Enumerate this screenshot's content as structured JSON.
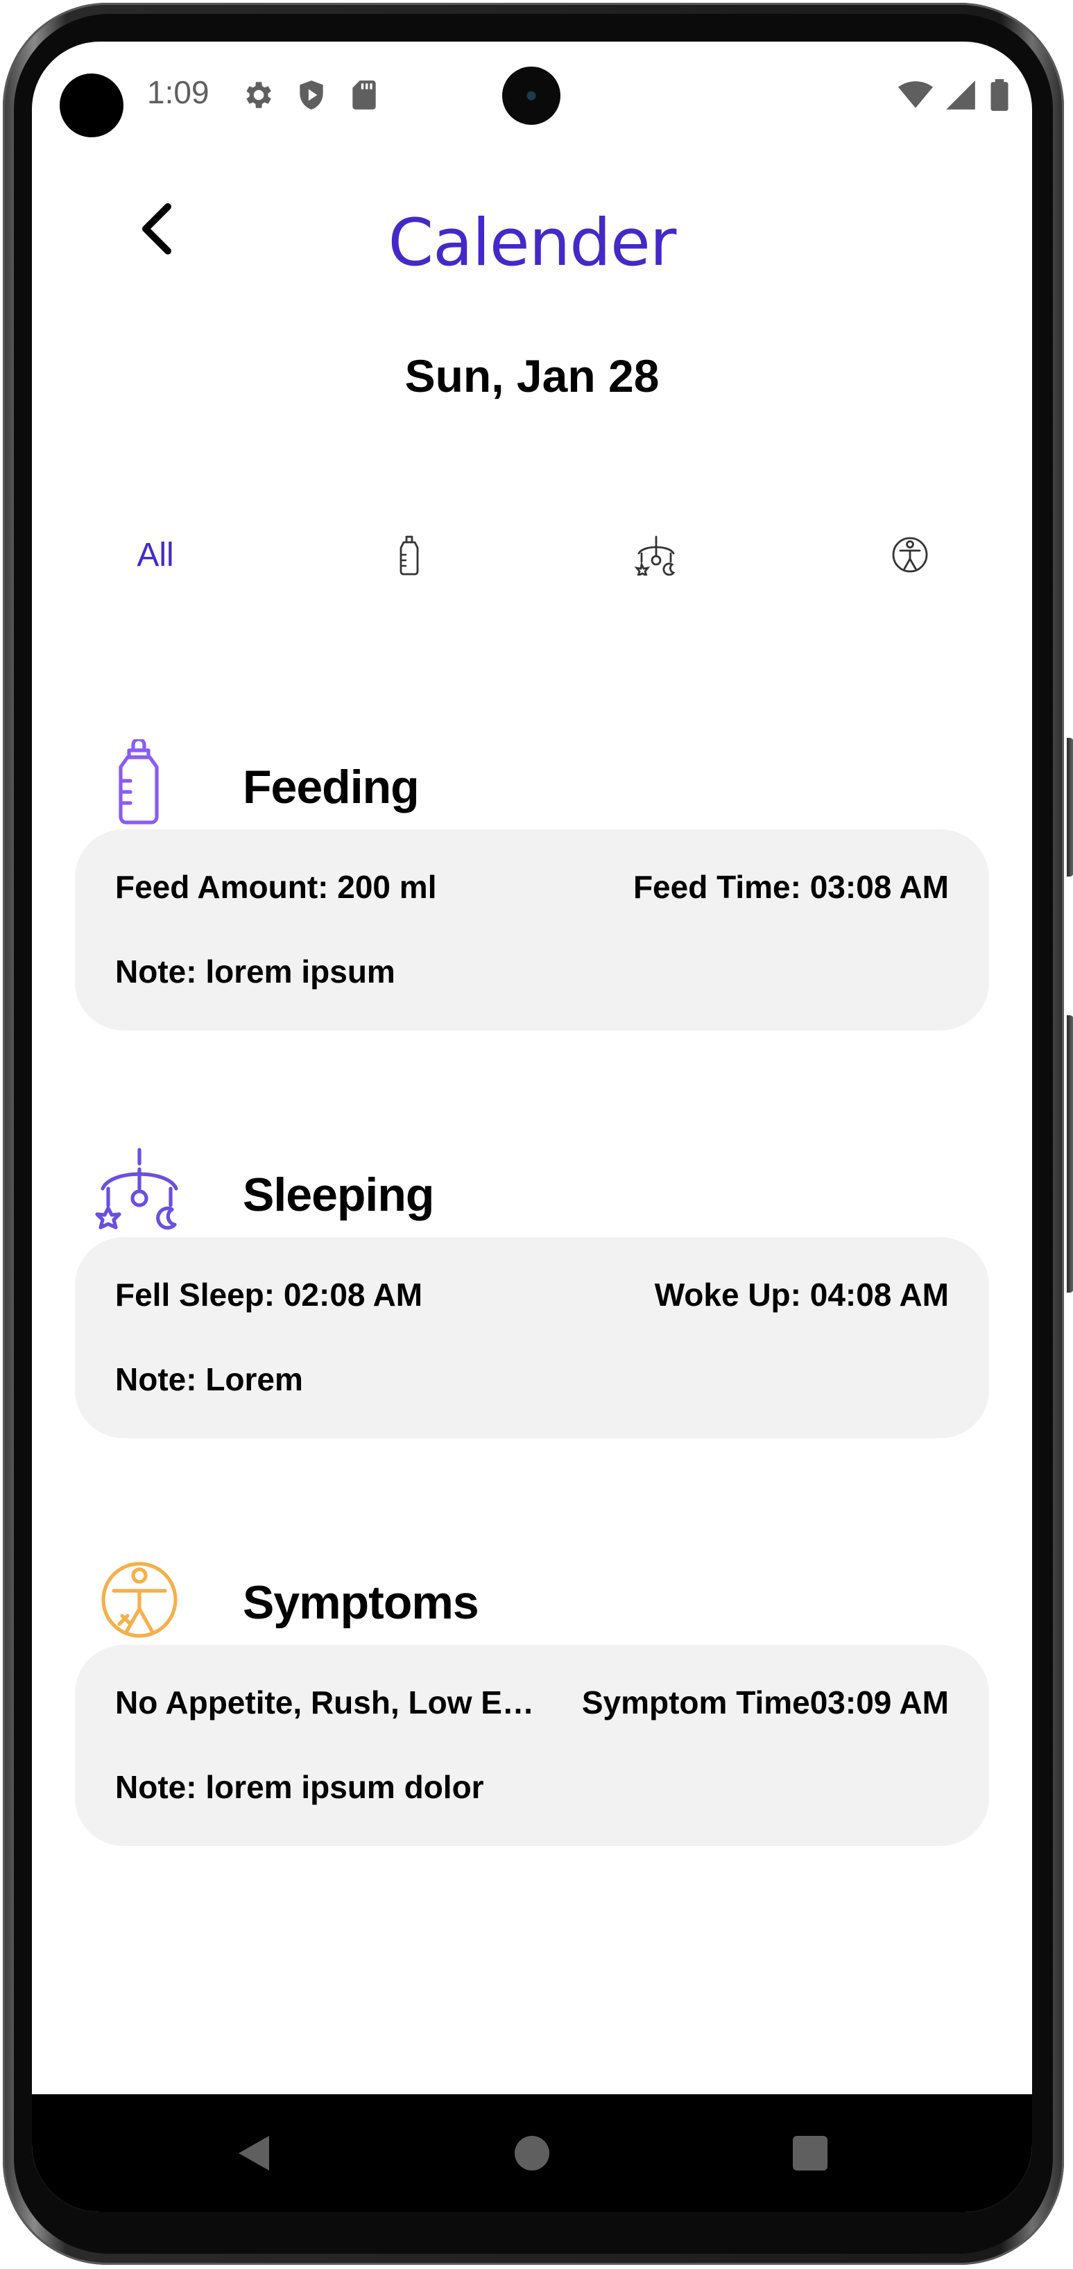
{
  "status_bar": {
    "time": "1:09",
    "icons": [
      "gear-icon",
      "shield-icon",
      "sd-card-icon",
      "wifi-icon",
      "cell-signal-icon",
      "battery-icon"
    ]
  },
  "header": {
    "title": "Calender",
    "date": "Sun, Jan 28"
  },
  "tabs": [
    {
      "label": "All",
      "selected": true
    },
    {
      "icon": "bottle-icon"
    },
    {
      "icon": "crib-mobile-icon"
    },
    {
      "icon": "symptom-icon"
    }
  ],
  "sections": {
    "feeding": {
      "title": "Feeding",
      "left": "Feed Amount: 200 ml",
      "right": "Feed Time: 03:08 AM",
      "note": "Note: lorem ipsum"
    },
    "sleeping": {
      "title": "Sleeping",
      "left": "Fell Sleep: 02:08 AM",
      "right": "Woke Up: 04:08 AM",
      "note": "Note: Lorem"
    },
    "symptoms": {
      "title": "Symptoms",
      "left": "No Appetite, Rush, Low En...",
      "right": "Symptom Time03:09 AM",
      "note": "Note: lorem ipsum dolor"
    }
  },
  "colors": {
    "accent": "#4529c8",
    "feeding_icon": "#8a5cf0",
    "sleeping_icon": "#6b4fe0",
    "symptoms_icon": "#f5b04a",
    "card_bg": "#f2f2f2"
  }
}
